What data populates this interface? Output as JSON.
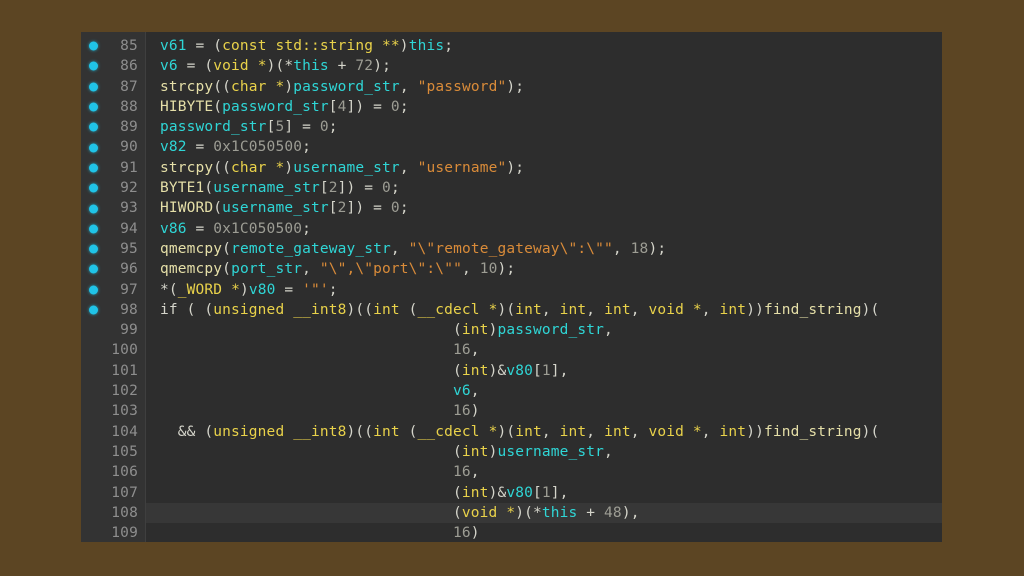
{
  "window": {
    "background_color": "#5c4523",
    "panel_background_color": "#2d2d2d",
    "gutter_background_color": "#333333",
    "current_line_highlight_color": "#373737"
  },
  "editor": {
    "name": "decompiler-code-view",
    "breakpoint_dot_color": "#20c4e8",
    "line_number_color": "#8e8e8e",
    "current_line": 108,
    "first_line_number": 85,
    "last_line_number": 109,
    "syntax_colors": {
      "variable": "#2fd6d6",
      "keyword": "#e9d24a",
      "string": "#d98b39",
      "number": "#9d9d94",
      "function": "#e5dfa8",
      "plain": "#d5d5cb"
    },
    "lines": [
      {
        "number": "85",
        "dot": true,
        "current": false,
        "tokens": [
          {
            "t": "v61",
            "c": "t-var"
          },
          {
            "t": " = ",
            "c": "t-pln"
          },
          {
            "t": "(",
            "c": "t-pln"
          },
          {
            "t": "const std::string",
            "c": "t-kw"
          },
          {
            "t": " ",
            "c": "t-pln"
          },
          {
            "t": "**",
            "c": "t-kw"
          },
          {
            "t": ")",
            "c": "t-pln"
          },
          {
            "t": "this",
            "c": "t-var"
          },
          {
            "t": ";",
            "c": "t-pln"
          }
        ]
      },
      {
        "number": "86",
        "dot": true,
        "current": false,
        "tokens": [
          {
            "t": "v6",
            "c": "t-var"
          },
          {
            "t": " = ",
            "c": "t-pln"
          },
          {
            "t": "(",
            "c": "t-pln"
          },
          {
            "t": "void",
            "c": "t-kw"
          },
          {
            "t": " ",
            "c": "t-pln"
          },
          {
            "t": "*",
            "c": "t-kw"
          },
          {
            "t": ")(*",
            "c": "t-pln"
          },
          {
            "t": "this",
            "c": "t-var"
          },
          {
            "t": " + ",
            "c": "t-pln"
          },
          {
            "t": "72",
            "c": "t-num"
          },
          {
            "t": ");",
            "c": "t-pln"
          }
        ]
      },
      {
        "number": "87",
        "dot": true,
        "current": false,
        "tokens": [
          {
            "t": "strcpy",
            "c": "t-fn"
          },
          {
            "t": "((",
            "c": "t-pln"
          },
          {
            "t": "char",
            "c": "t-kw"
          },
          {
            "t": " ",
            "c": "t-pln"
          },
          {
            "t": "*",
            "c": "t-kw"
          },
          {
            "t": ")",
            "c": "t-pln"
          },
          {
            "t": "password_str",
            "c": "t-var"
          },
          {
            "t": ", ",
            "c": "t-pln"
          },
          {
            "t": "\"password\"",
            "c": "t-str"
          },
          {
            "t": ");",
            "c": "t-pln"
          }
        ]
      },
      {
        "number": "88",
        "dot": true,
        "current": false,
        "tokens": [
          {
            "t": "HIBYTE",
            "c": "t-fn"
          },
          {
            "t": "(",
            "c": "t-pln"
          },
          {
            "t": "password_str",
            "c": "t-var"
          },
          {
            "t": "[",
            "c": "t-pln"
          },
          {
            "t": "4",
            "c": "t-num"
          },
          {
            "t": "]) = ",
            "c": "t-pln"
          },
          {
            "t": "0",
            "c": "t-num"
          },
          {
            "t": ";",
            "c": "t-pln"
          }
        ]
      },
      {
        "number": "89",
        "dot": true,
        "current": false,
        "tokens": [
          {
            "t": "password_str",
            "c": "t-var"
          },
          {
            "t": "[",
            "c": "t-pln"
          },
          {
            "t": "5",
            "c": "t-num"
          },
          {
            "t": "] = ",
            "c": "t-pln"
          },
          {
            "t": "0",
            "c": "t-num"
          },
          {
            "t": ";",
            "c": "t-pln"
          }
        ]
      },
      {
        "number": "90",
        "dot": true,
        "current": false,
        "tokens": [
          {
            "t": "v82",
            "c": "t-var"
          },
          {
            "t": " = ",
            "c": "t-pln"
          },
          {
            "t": "0x1C050500",
            "c": "t-num"
          },
          {
            "t": ";",
            "c": "t-pln"
          }
        ]
      },
      {
        "number": "91",
        "dot": true,
        "current": false,
        "tokens": [
          {
            "t": "strcpy",
            "c": "t-fn"
          },
          {
            "t": "((",
            "c": "t-pln"
          },
          {
            "t": "char",
            "c": "t-kw"
          },
          {
            "t": " ",
            "c": "t-pln"
          },
          {
            "t": "*",
            "c": "t-kw"
          },
          {
            "t": ")",
            "c": "t-pln"
          },
          {
            "t": "username_str",
            "c": "t-var"
          },
          {
            "t": ", ",
            "c": "t-pln"
          },
          {
            "t": "\"username\"",
            "c": "t-str"
          },
          {
            "t": ");",
            "c": "t-pln"
          }
        ]
      },
      {
        "number": "92",
        "dot": true,
        "current": false,
        "tokens": [
          {
            "t": "BYTE1",
            "c": "t-fn"
          },
          {
            "t": "(",
            "c": "t-pln"
          },
          {
            "t": "username_str",
            "c": "t-var"
          },
          {
            "t": "[",
            "c": "t-pln"
          },
          {
            "t": "2",
            "c": "t-num"
          },
          {
            "t": "]) = ",
            "c": "t-pln"
          },
          {
            "t": "0",
            "c": "t-num"
          },
          {
            "t": ";",
            "c": "t-pln"
          }
        ]
      },
      {
        "number": "93",
        "dot": true,
        "current": false,
        "tokens": [
          {
            "t": "HIWORD",
            "c": "t-fn"
          },
          {
            "t": "(",
            "c": "t-pln"
          },
          {
            "t": "username_str",
            "c": "t-var"
          },
          {
            "t": "[",
            "c": "t-pln"
          },
          {
            "t": "2",
            "c": "t-num"
          },
          {
            "t": "]) = ",
            "c": "t-pln"
          },
          {
            "t": "0",
            "c": "t-num"
          },
          {
            "t": ";",
            "c": "t-pln"
          }
        ]
      },
      {
        "number": "94",
        "dot": true,
        "current": false,
        "tokens": [
          {
            "t": "v86",
            "c": "t-var"
          },
          {
            "t": " = ",
            "c": "t-pln"
          },
          {
            "t": "0x1C050500",
            "c": "t-num"
          },
          {
            "t": ";",
            "c": "t-pln"
          }
        ]
      },
      {
        "number": "95",
        "dot": true,
        "current": false,
        "tokens": [
          {
            "t": "qmemcpy",
            "c": "t-fn"
          },
          {
            "t": "(",
            "c": "t-pln"
          },
          {
            "t": "remote_gateway_str",
            "c": "t-var"
          },
          {
            "t": ", ",
            "c": "t-pln"
          },
          {
            "t": "\"\\\"remote_gateway\\\":\\\"\"",
            "c": "t-str"
          },
          {
            "t": ", ",
            "c": "t-pln"
          },
          {
            "t": "18",
            "c": "t-num"
          },
          {
            "t": ");",
            "c": "t-pln"
          }
        ]
      },
      {
        "number": "96",
        "dot": true,
        "current": false,
        "tokens": [
          {
            "t": "qmemcpy",
            "c": "t-fn"
          },
          {
            "t": "(",
            "c": "t-pln"
          },
          {
            "t": "port_str",
            "c": "t-var"
          },
          {
            "t": ", ",
            "c": "t-pln"
          },
          {
            "t": "\"\\\",\\\"port\\\":\\\"\"",
            "c": "t-str"
          },
          {
            "t": ", ",
            "c": "t-pln"
          },
          {
            "t": "10",
            "c": "t-num"
          },
          {
            "t": ");",
            "c": "t-pln"
          }
        ]
      },
      {
        "number": "97",
        "dot": true,
        "current": false,
        "tokens": [
          {
            "t": "*(",
            "c": "t-pln"
          },
          {
            "t": "_WORD",
            "c": "t-kw"
          },
          {
            "t": " ",
            "c": "t-pln"
          },
          {
            "t": "*",
            "c": "t-kw"
          },
          {
            "t": ")",
            "c": "t-pln"
          },
          {
            "t": "v80",
            "c": "t-var"
          },
          {
            "t": " = ",
            "c": "t-pln"
          },
          {
            "t": "'\"'",
            "c": "t-str"
          },
          {
            "t": ";",
            "c": "t-pln"
          }
        ]
      },
      {
        "number": "98",
        "dot": true,
        "current": false,
        "tokens": [
          {
            "t": "if ( (",
            "c": "t-pln"
          },
          {
            "t": "unsigned __int8",
            "c": "t-kw"
          },
          {
            "t": ")((",
            "c": "t-pln"
          },
          {
            "t": "int",
            "c": "t-kw"
          },
          {
            "t": " (",
            "c": "t-pln"
          },
          {
            "t": "__cdecl",
            "c": "t-kw"
          },
          {
            "t": " ",
            "c": "t-pln"
          },
          {
            "t": "*",
            "c": "t-kw"
          },
          {
            "t": ")(",
            "c": "t-pln"
          },
          {
            "t": "int",
            "c": "t-kw"
          },
          {
            "t": ", ",
            "c": "t-pln"
          },
          {
            "t": "int",
            "c": "t-kw"
          },
          {
            "t": ", ",
            "c": "t-pln"
          },
          {
            "t": "int",
            "c": "t-kw"
          },
          {
            "t": ", ",
            "c": "t-pln"
          },
          {
            "t": "void",
            "c": "t-kw"
          },
          {
            "t": " ",
            "c": "t-pln"
          },
          {
            "t": "*",
            "c": "t-kw"
          },
          {
            "t": ", ",
            "c": "t-pln"
          },
          {
            "t": "int",
            "c": "t-kw"
          },
          {
            "t": "))",
            "c": "t-pln"
          },
          {
            "t": "find_string",
            "c": "t-fn"
          },
          {
            "t": ")(",
            "c": "t-pln"
          }
        ]
      },
      {
        "number": "99",
        "dot": false,
        "current": false,
        "tokens": [
          {
            "t": "                                 (",
            "c": "t-pln"
          },
          {
            "t": "int",
            "c": "t-kw"
          },
          {
            "t": ")",
            "c": "t-pln"
          },
          {
            "t": "password_str",
            "c": "t-var"
          },
          {
            "t": ",",
            "c": "t-pln"
          }
        ]
      },
      {
        "number": "100",
        "dot": false,
        "current": false,
        "tokens": [
          {
            "t": "                                 ",
            "c": "t-pln"
          },
          {
            "t": "16",
            "c": "t-num"
          },
          {
            "t": ",",
            "c": "t-pln"
          }
        ]
      },
      {
        "number": "101",
        "dot": false,
        "current": false,
        "tokens": [
          {
            "t": "                                 (",
            "c": "t-pln"
          },
          {
            "t": "int",
            "c": "t-kw"
          },
          {
            "t": ")&",
            "c": "t-pln"
          },
          {
            "t": "v80",
            "c": "t-var"
          },
          {
            "t": "[",
            "c": "t-pln"
          },
          {
            "t": "1",
            "c": "t-num"
          },
          {
            "t": "],",
            "c": "t-pln"
          }
        ]
      },
      {
        "number": "102",
        "dot": false,
        "current": false,
        "tokens": [
          {
            "t": "                                 ",
            "c": "t-pln"
          },
          {
            "t": "v6",
            "c": "t-var"
          },
          {
            "t": ",",
            "c": "t-pln"
          }
        ]
      },
      {
        "number": "103",
        "dot": false,
        "current": false,
        "tokens": [
          {
            "t": "                                 ",
            "c": "t-pln"
          },
          {
            "t": "16",
            "c": "t-num"
          },
          {
            "t": ")",
            "c": "t-pln"
          }
        ]
      },
      {
        "number": "104",
        "dot": false,
        "current": false,
        "tokens": [
          {
            "t": "  && (",
            "c": "t-pln"
          },
          {
            "t": "unsigned __int8",
            "c": "t-kw"
          },
          {
            "t": ")((",
            "c": "t-pln"
          },
          {
            "t": "int",
            "c": "t-kw"
          },
          {
            "t": " (",
            "c": "t-pln"
          },
          {
            "t": "__cdecl",
            "c": "t-kw"
          },
          {
            "t": " ",
            "c": "t-pln"
          },
          {
            "t": "*",
            "c": "t-kw"
          },
          {
            "t": ")(",
            "c": "t-pln"
          },
          {
            "t": "int",
            "c": "t-kw"
          },
          {
            "t": ", ",
            "c": "t-pln"
          },
          {
            "t": "int",
            "c": "t-kw"
          },
          {
            "t": ", ",
            "c": "t-pln"
          },
          {
            "t": "int",
            "c": "t-kw"
          },
          {
            "t": ", ",
            "c": "t-pln"
          },
          {
            "t": "void",
            "c": "t-kw"
          },
          {
            "t": " ",
            "c": "t-pln"
          },
          {
            "t": "*",
            "c": "t-kw"
          },
          {
            "t": ", ",
            "c": "t-pln"
          },
          {
            "t": "int",
            "c": "t-kw"
          },
          {
            "t": "))",
            "c": "t-pln"
          },
          {
            "t": "find_string",
            "c": "t-fn"
          },
          {
            "t": ")(",
            "c": "t-pln"
          }
        ]
      },
      {
        "number": "105",
        "dot": false,
        "current": false,
        "tokens": [
          {
            "t": "                                 (",
            "c": "t-pln"
          },
          {
            "t": "int",
            "c": "t-kw"
          },
          {
            "t": ")",
            "c": "t-pln"
          },
          {
            "t": "username_str",
            "c": "t-var"
          },
          {
            "t": ",",
            "c": "t-pln"
          }
        ]
      },
      {
        "number": "106",
        "dot": false,
        "current": false,
        "tokens": [
          {
            "t": "                                 ",
            "c": "t-pln"
          },
          {
            "t": "16",
            "c": "t-num"
          },
          {
            "t": ",",
            "c": "t-pln"
          }
        ]
      },
      {
        "number": "107",
        "dot": false,
        "current": false,
        "tokens": [
          {
            "t": "                                 (",
            "c": "t-pln"
          },
          {
            "t": "int",
            "c": "t-kw"
          },
          {
            "t": ")&",
            "c": "t-pln"
          },
          {
            "t": "v80",
            "c": "t-var"
          },
          {
            "t": "[",
            "c": "t-pln"
          },
          {
            "t": "1",
            "c": "t-num"
          },
          {
            "t": "],",
            "c": "t-pln"
          }
        ]
      },
      {
        "number": "108",
        "dot": false,
        "current": true,
        "tokens": [
          {
            "t": "                                 (",
            "c": "t-pln"
          },
          {
            "t": "void",
            "c": "t-kw"
          },
          {
            "t": " ",
            "c": "t-pln"
          },
          {
            "t": "*",
            "c": "t-kw"
          },
          {
            "t": ")(*",
            "c": "t-pln"
          },
          {
            "t": "this",
            "c": "t-var"
          },
          {
            "t": " + ",
            "c": "t-pln"
          },
          {
            "t": "48",
            "c": "t-num"
          },
          {
            "t": "),",
            "c": "t-pln"
          }
        ]
      },
      {
        "number": "109",
        "dot": false,
        "current": false,
        "tokens": [
          {
            "t": "                                 ",
            "c": "t-pln"
          },
          {
            "t": "16",
            "c": "t-num"
          },
          {
            "t": ")",
            "c": "t-pln"
          }
        ]
      }
    ]
  }
}
